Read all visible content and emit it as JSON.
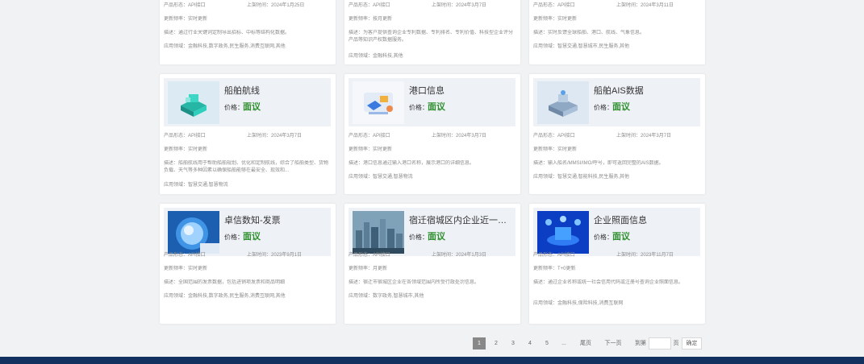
{
  "labels": {
    "form": "产品形态：",
    "listed": "上架时间：",
    "freq": "更新频率：",
    "desc": "描述：",
    "field": "应用领域：",
    "price": "价格："
  },
  "cards": [
    {
      "title": "",
      "price": "",
      "form": "API接口",
      "listed": "2024年1月25日",
      "freq": "实时更新",
      "desc": "通过行业关键词定制导出招标、中标等结构化数据。",
      "field": "金融科技,数字政务,民生服务,消费互联网,其他"
    },
    {
      "title": "",
      "price": "",
      "form": "API接口",
      "listed": "2024年3月7日",
      "freq": "按月更新",
      "desc": "为客户提供查询企业专利数据、专利排名、专利价值、科技型企业评分产品等知识产权数据服务。",
      "field": "金融科技,其他"
    },
    {
      "title": "",
      "price": "",
      "form": "API接口",
      "listed": "2024年3月11日",
      "freq": "实时更新",
      "desc": "实时反馈全球船舶、港口、航线、气象信息。",
      "field": "智慧交通,智慧城市,民生服务,其他"
    },
    {
      "title": "船舶航线",
      "price": "面议",
      "form": "API接口",
      "listed": "2024年3月7日",
      "freq": "实时更新",
      "desc": "船舶航线用于帮助船舶规划、优化和定制航线，综合了船舶类型、货物负载、天气等多种因素以确保船舶能够在最安全、现效和...",
      "field": "智慧交通,智慧物流"
    },
    {
      "title": "港口信息",
      "price": "面议",
      "form": "API接口",
      "listed": "2024年3月7日",
      "freq": "实时更新",
      "desc": "港口信息通过输入港口名称，展示港口的详细信息。",
      "field": "智慧交通,智慧物流"
    },
    {
      "title": "船舶AIS数据",
      "price": "面议",
      "form": "API接口",
      "listed": "2024年3月7日",
      "freq": "实时更新",
      "desc": "输入船名/MMSI/IMO/呼号，即可返回完整的AIS数据。",
      "field": "智慧交通,智能科技,民生服务,其他"
    },
    {
      "title": "卓信数知-发票",
      "price": "面议",
      "form": "API接口",
      "listed": "2023年9月1日",
      "freq": "实时更新",
      "desc": "全国范围的发票数据，包括进销项发票和商品明细",
      "field": "金融科技,数字政务,民生服务,消费互联网,其他"
    },
    {
      "title": "宿迁宿城区内企业近一年...",
      "price": "面议",
      "form": "API接口",
      "listed": "2024年1月3日",
      "freq": "月更新",
      "desc": "宿迁市宿城区企业在各领域范围内所受行政处罚信息。",
      "field": "数字政务,智慧城市,其他"
    },
    {
      "title": "企业照面信息",
      "price": "面议",
      "form": "API接口",
      "listed": "2023年11月7日",
      "freq": "T+0更新",
      "desc": "通过企业名称或统一社会信用代码或注册号查询企业照面信息。",
      "field": "金融科技,保险科技,消费互联网"
    }
  ],
  "pagination": {
    "pages": [
      "1",
      "2",
      "3",
      "4",
      "5"
    ],
    "ellipsis": "...",
    "last": "尾页",
    "next": "下一页",
    "goto_prefix": "到第",
    "goto_suffix": "页",
    "confirm": "确定"
  },
  "colors": {
    "price": "#2f8f2f",
    "footer": "#13315f"
  }
}
